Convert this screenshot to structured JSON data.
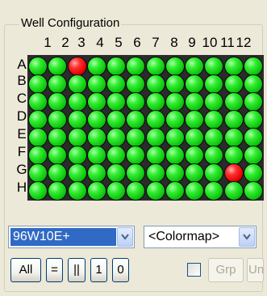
{
  "group": {
    "title": "Well Configuration"
  },
  "columns": [
    "1",
    "2",
    "3",
    "4",
    "5",
    "6",
    "7",
    "8",
    "9",
    "10",
    "11",
    "12"
  ],
  "rows": [
    "A",
    "B",
    "C",
    "D",
    "E",
    "F",
    "G",
    "H"
  ],
  "wells_red": [
    "A3",
    "G11"
  ],
  "colors": {
    "well_default": "#22dd22",
    "well_selected": "#ee0000",
    "plate_background": "#2b2b2b",
    "combo_highlight": "#316ac5"
  },
  "plate_combo": {
    "value": "96W10E+"
  },
  "colormap_combo": {
    "value": "<Colormap>"
  },
  "buttons": {
    "all": "All",
    "equals": "=",
    "parallel": "||",
    "one": "1",
    "zero": "0",
    "group": "Grp",
    "ungroup": "Un-Grp"
  },
  "checkbox": {
    "checked": false
  }
}
